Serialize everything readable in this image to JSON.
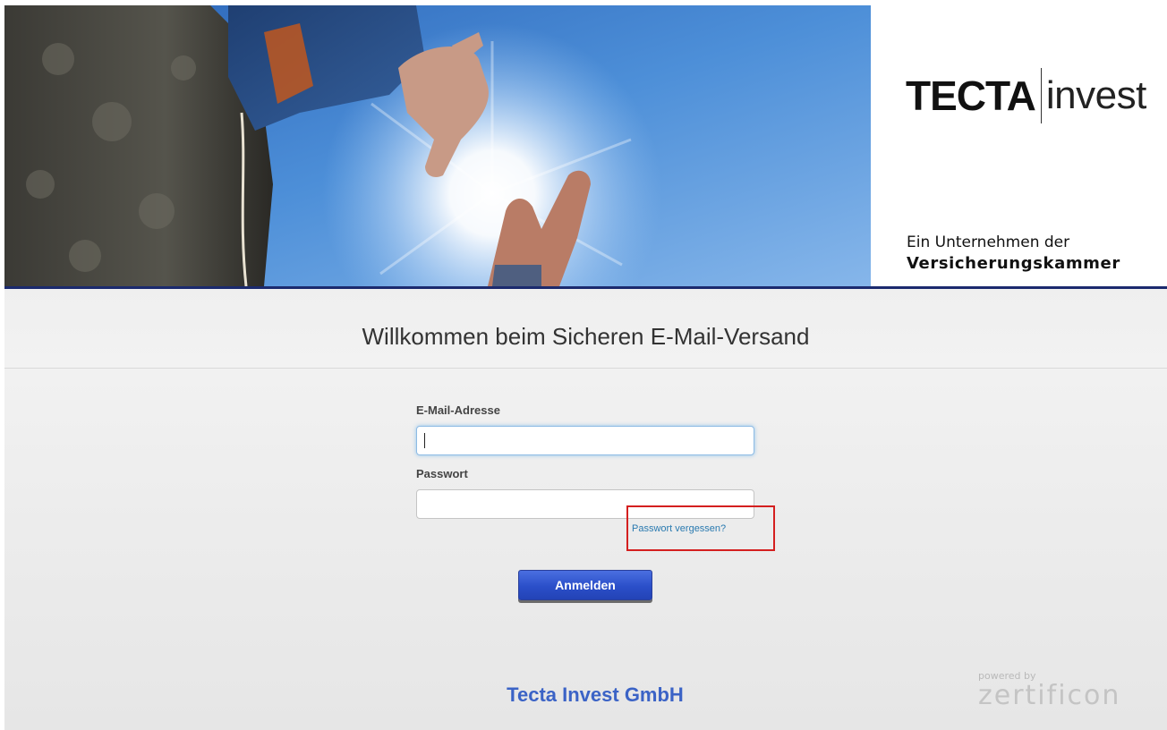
{
  "header": {
    "brand_name": "TECTA",
    "brand_suffix": "invest",
    "tagline_line1": "Ein Unternehmen der",
    "tagline_line2": "Versicherungskammer"
  },
  "main": {
    "welcome_title": "Willkommen beim Sicheren E-Mail-Versand",
    "email_label": "E-Mail-Adresse",
    "email_value": "",
    "password_label": "Passwort",
    "password_value": "",
    "forgot_password": "Passwort vergessen?",
    "login_button": "Anmelden"
  },
  "footer": {
    "company_name": "Tecta Invest GmbH",
    "powered_by": "powered by",
    "powered_brand": "zertificon"
  },
  "colors": {
    "header_rule": "#1b2a6e",
    "button": "#2b4fc9",
    "company_name": "#3b63c6",
    "link": "#2a7ab0",
    "highlight_box": "#d41f1f"
  },
  "icons": {
    "hero_image": "climber-hands-sun-photo"
  }
}
